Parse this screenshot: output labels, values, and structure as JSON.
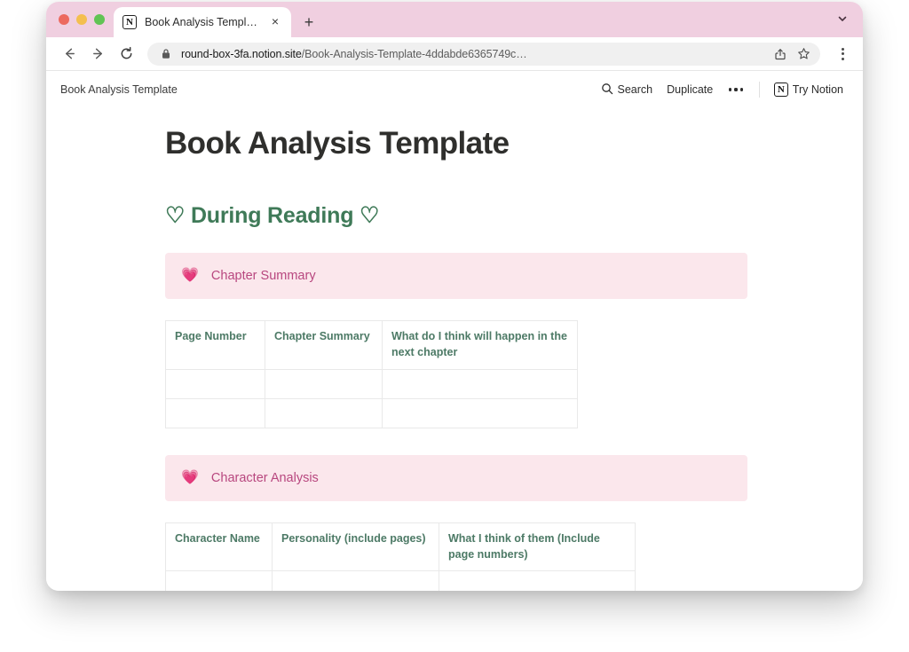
{
  "browser": {
    "traffic_lights": [
      "close",
      "minimize",
      "maximize"
    ],
    "tab": {
      "favicon": "notion-logo-icon",
      "title": "Book Analysis Template",
      "close_label": "×"
    },
    "new_tab_label": "+",
    "tab_list_chevron": "chevron-down-icon",
    "toolbar": {
      "back_icon": "back-arrow-icon",
      "forward_icon": "forward-arrow-icon",
      "reload_icon": "reload-icon",
      "lock_icon": "lock-icon",
      "url_host": "round-box-3fa.notion.site",
      "url_path": "/Book-Analysis-Template-4ddabde6365749c…",
      "share_icon": "share-icon",
      "bookmark_icon": "star-icon",
      "menu_icon": "kebab-menu-icon"
    }
  },
  "notion": {
    "topbar": {
      "breadcrumb": "Book Analysis Template",
      "search_label": "Search",
      "duplicate_label": "Duplicate",
      "more_label": "•••",
      "try_notion_label": "Try Notion"
    },
    "page_title": "Book Analysis Template",
    "section_heading": "♡ During Reading ♡",
    "colors": {
      "heading_green": "#3f7a58",
      "callout_bg": "#fbe7ec",
      "callout_text": "#b8477f",
      "table_header_text": "#4d7a66",
      "chrome_pink": "#f0cfe0"
    },
    "blocks": [
      {
        "type": "callout",
        "emoji": "💗",
        "emoji_name": "growing-heart-emoji",
        "text": "Chapter Summary"
      },
      {
        "type": "table",
        "name": "chapter-summary-table",
        "headers": [
          "Page Number",
          "Chapter Summary",
          "What do I think will happen in the next chapter"
        ],
        "rows": [
          [
            "",
            "",
            ""
          ],
          [
            "",
            "",
            ""
          ]
        ]
      },
      {
        "type": "callout",
        "emoji": "💗",
        "emoji_name": "growing-heart-emoji",
        "text": "Character Analysis"
      },
      {
        "type": "table",
        "name": "character-analysis-table",
        "headers": [
          "Character Name",
          "Personality (include pages)",
          "What I think of them (Include page numbers)"
        ],
        "rows": [
          [
            "",
            "",
            ""
          ],
          [
            "",
            "",
            ""
          ]
        ]
      }
    ]
  }
}
